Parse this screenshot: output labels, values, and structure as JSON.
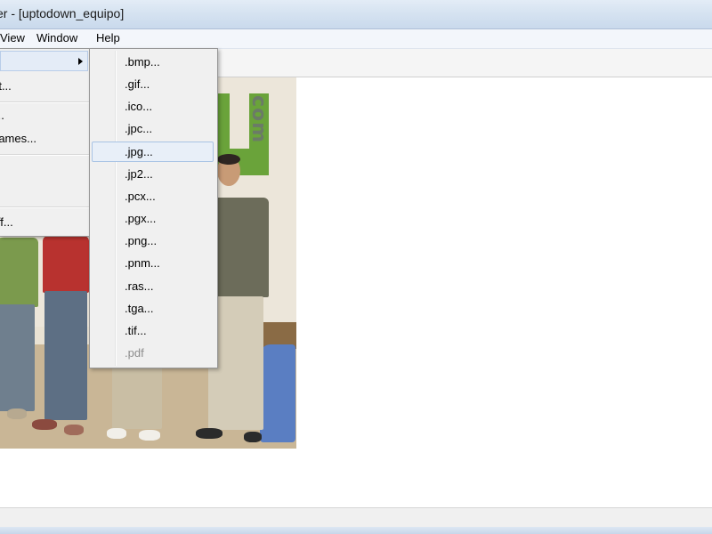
{
  "window": {
    "title": "er - [uptodown_equipo]"
  },
  "menubar": {
    "items": [
      "View",
      "Window",
      "Help"
    ]
  },
  "parent_menu": {
    "items": [
      {
        "label": "",
        "has_submenu": true
      },
      {
        "label": "rt..."
      },
      {
        "label": "..."
      },
      {
        "label": "rames..."
      },
      {
        "label": "iff..."
      }
    ]
  },
  "submenu": {
    "items": [
      {
        "label": ".bmp..."
      },
      {
        "label": ".gif..."
      },
      {
        "label": ".ico..."
      },
      {
        "label": ".jpc..."
      },
      {
        "label": ".jpg...",
        "highlighted": true
      },
      {
        "label": ".jp2..."
      },
      {
        "label": ".pcx..."
      },
      {
        "label": ".pgx..."
      },
      {
        "label": ".png..."
      },
      {
        "label": ".pnm..."
      },
      {
        "label": ".ras..."
      },
      {
        "label": ".tga..."
      },
      {
        "label": ".tif..."
      },
      {
        "label": ".pdf",
        "disabled": true
      }
    ]
  },
  "image": {
    "logo_text": "com"
  },
  "colors": {
    "menu_bg": "#f0f0f0",
    "highlight_bg": "#e8eff8",
    "highlight_border": "#a8c3e4",
    "disabled_text": "#8d8d8d"
  }
}
